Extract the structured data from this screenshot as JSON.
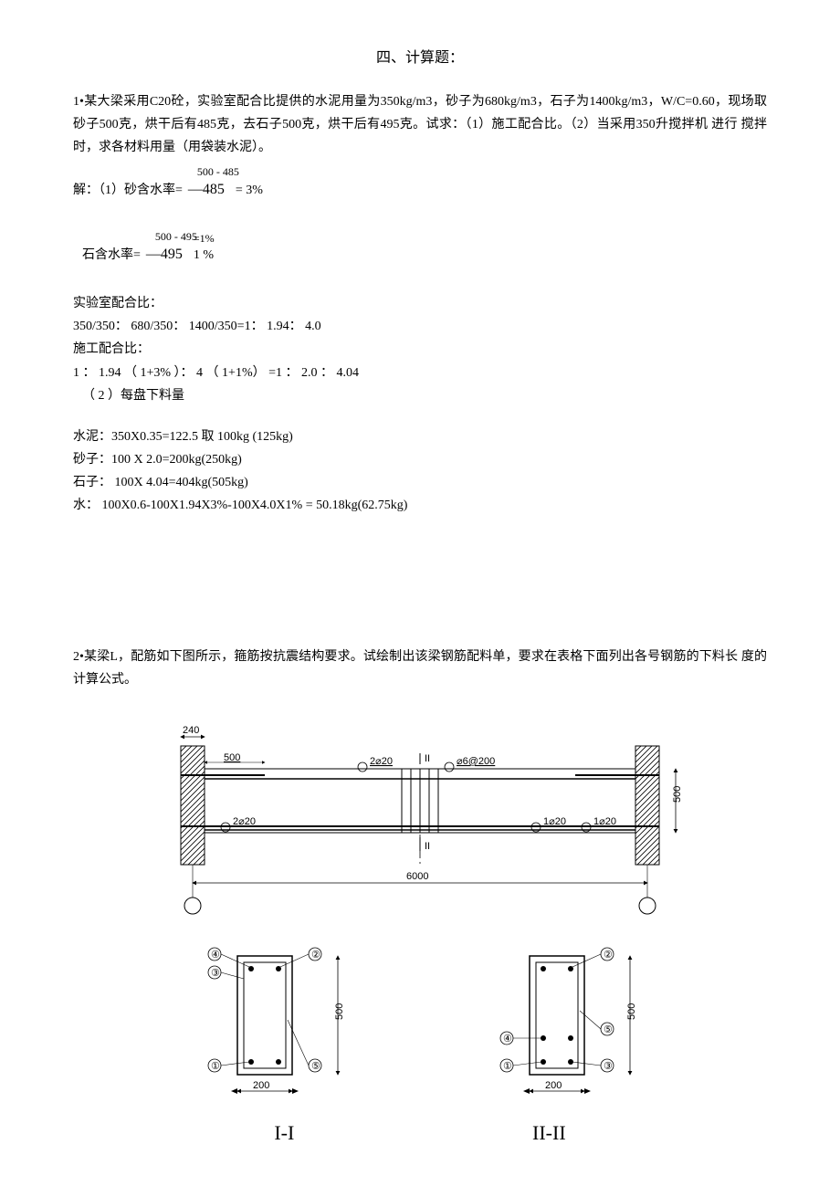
{
  "title": "四、计算题：",
  "problem1": {
    "stmt1": "1•某大梁采用C20砼，实验室配合比提供的水泥用量为350kg/m3，砂子为680kg/m3，石子为1400kg/m3，W/C=0.60，现场取 砂子500克，烘干后有485克，去石子500克，烘干后有495克。试求：（1）施工配合比。（2）当采用350升搅拌机 进行 搅拌时，求各材料用量（用袋装水泥）。",
    "sol_label1": "解：（1）砂含水率=",
    "sol_frac1_top": "500 - 485",
    "sol_frac1_bot": "—485",
    "sol_frac1_eq": "= 3%",
    "sol_label2": "石含水率=",
    "sol_frac2_top": "500 - 495",
    "sol_frac2_bot": "—495",
    "sol_frac2_eq": "=1%",
    "sol_frac2_eq2": "1 %",
    "line_lab": "实验室配合比：",
    "line_lab_val": "350/350： 680/350： 1400/350=1： 1.94： 4.0",
    "line_con": "施工配合比：",
    "line_con_val": "1 ： 1.94 （ 1+3% ）： 4 （ 1+1%） =1 ： 2.0 ： 4.04",
    "line_batch": "（ 2 ）每盘下料量",
    "mat_cement": "水泥：350X0.35=122.5 取 100kg (125kg)",
    "mat_sand": "砂子：100 X 2.0=200kg(250kg)",
    "mat_stone": "石子： 100X 4.04=404kg(505kg)",
    "mat_water": "水： 100X0.6-100X1.94X3%-100X4.0X1% = 50.18kg(62.75kg)"
  },
  "problem2": {
    "stmt": "2•某梁L，配筋如下图所示，箍筋按抗震结构要求。试绘制出该梁钢筋配料单，要求在表格下面列出各号钢筋的下料长 度的计算公式。"
  },
  "diagram": {
    "top_col_left": "240",
    "top_bar_left": "500",
    "top_bar_mid": "2⌀20",
    "top_stirrup": "⌀6@200",
    "right_height": "500",
    "bottom_bar_left": "2⌀20",
    "bottom_bar_right1": "1⌀20",
    "bottom_bar_right2": "1⌀20",
    "span": "6000",
    "section_width": "200",
    "section_height": "500",
    "sec1": "I-I",
    "sec2": "II-II",
    "tag1": "①",
    "tag2": "②",
    "tag3": "③",
    "tag4": "④",
    "tag5": "⑤"
  }
}
